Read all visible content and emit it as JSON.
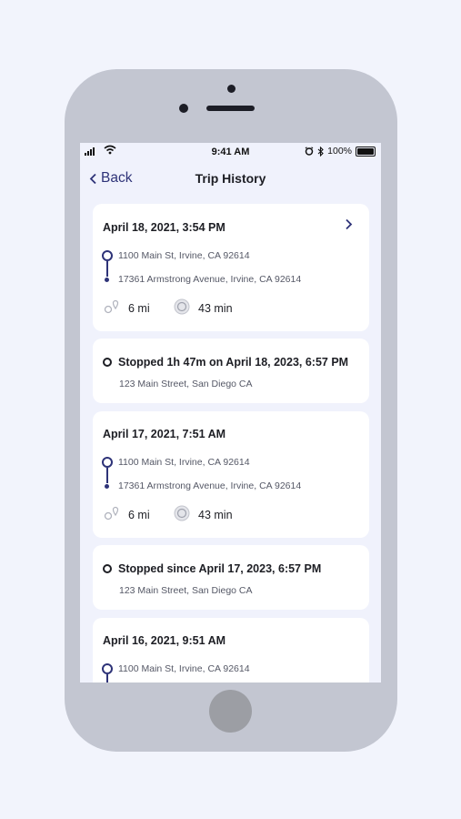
{
  "colors": {
    "accent": "#2e3378",
    "background": "#f0f2fc",
    "card": "#ffffff",
    "text": "#1d1e24",
    "muted": "#555866"
  },
  "status_bar": {
    "time": "9:41 AM",
    "battery": "100%",
    "icons": [
      "signal-icon",
      "wifi-icon",
      "alarm-icon",
      "bluetooth-icon",
      "battery-icon"
    ]
  },
  "nav": {
    "back_label": "Back",
    "title": "Trip History"
  },
  "trips": [
    {
      "date": "April 18, 2021, 3:54 PM",
      "from": "1100 Main St, Irvine, CA 92614",
      "to": "17361 Armstrong Avenue, Irvine, CA 92614",
      "distance": "6 mi",
      "duration": "43 min"
    },
    {
      "date": "April 17, 2021, 7:51 AM",
      "from": "1100 Main St, Irvine, CA 92614",
      "to": "17361 Armstrong Avenue, Irvine, CA 92614",
      "distance": "6 mi",
      "duration": "43 min"
    },
    {
      "date": "April 16, 2021, 9:51 AM",
      "from": "1100 Main St, Irvine, CA 92614"
    }
  ],
  "stops": [
    {
      "title": "Stopped 1h 47m on April 18, 2023, 6:57 PM",
      "address": "123 Main Street, San Diego CA"
    },
    {
      "title": "Stopped since April 17, 2023, 6:57 PM",
      "address": "123 Main Street, San Diego CA"
    }
  ]
}
